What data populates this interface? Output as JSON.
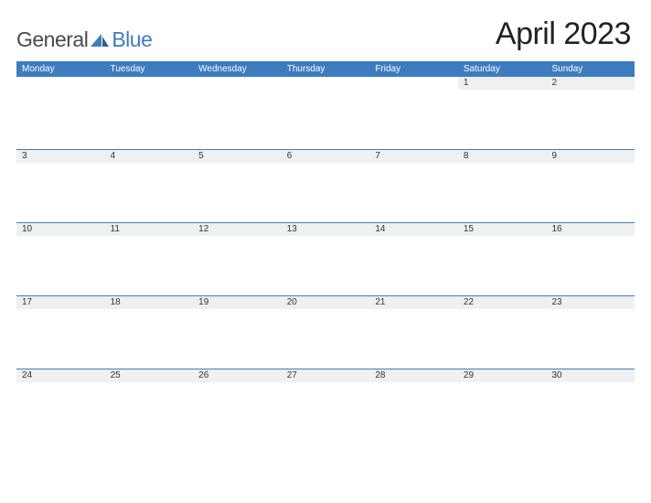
{
  "logo": {
    "word1": "General",
    "word2": "Blue"
  },
  "title": "April 2023",
  "dow": [
    "Monday",
    "Tuesday",
    "Wednesday",
    "Thursday",
    "Friday",
    "Saturday",
    "Sunday"
  ],
  "weeks": [
    [
      "",
      "",
      "",
      "",
      "",
      "1",
      "2"
    ],
    [
      "3",
      "4",
      "5",
      "6",
      "7",
      "8",
      "9"
    ],
    [
      "10",
      "11",
      "12",
      "13",
      "14",
      "15",
      "16"
    ],
    [
      "17",
      "18",
      "19",
      "20",
      "21",
      "22",
      "23"
    ],
    [
      "24",
      "25",
      "26",
      "27",
      "28",
      "29",
      "30"
    ]
  ]
}
